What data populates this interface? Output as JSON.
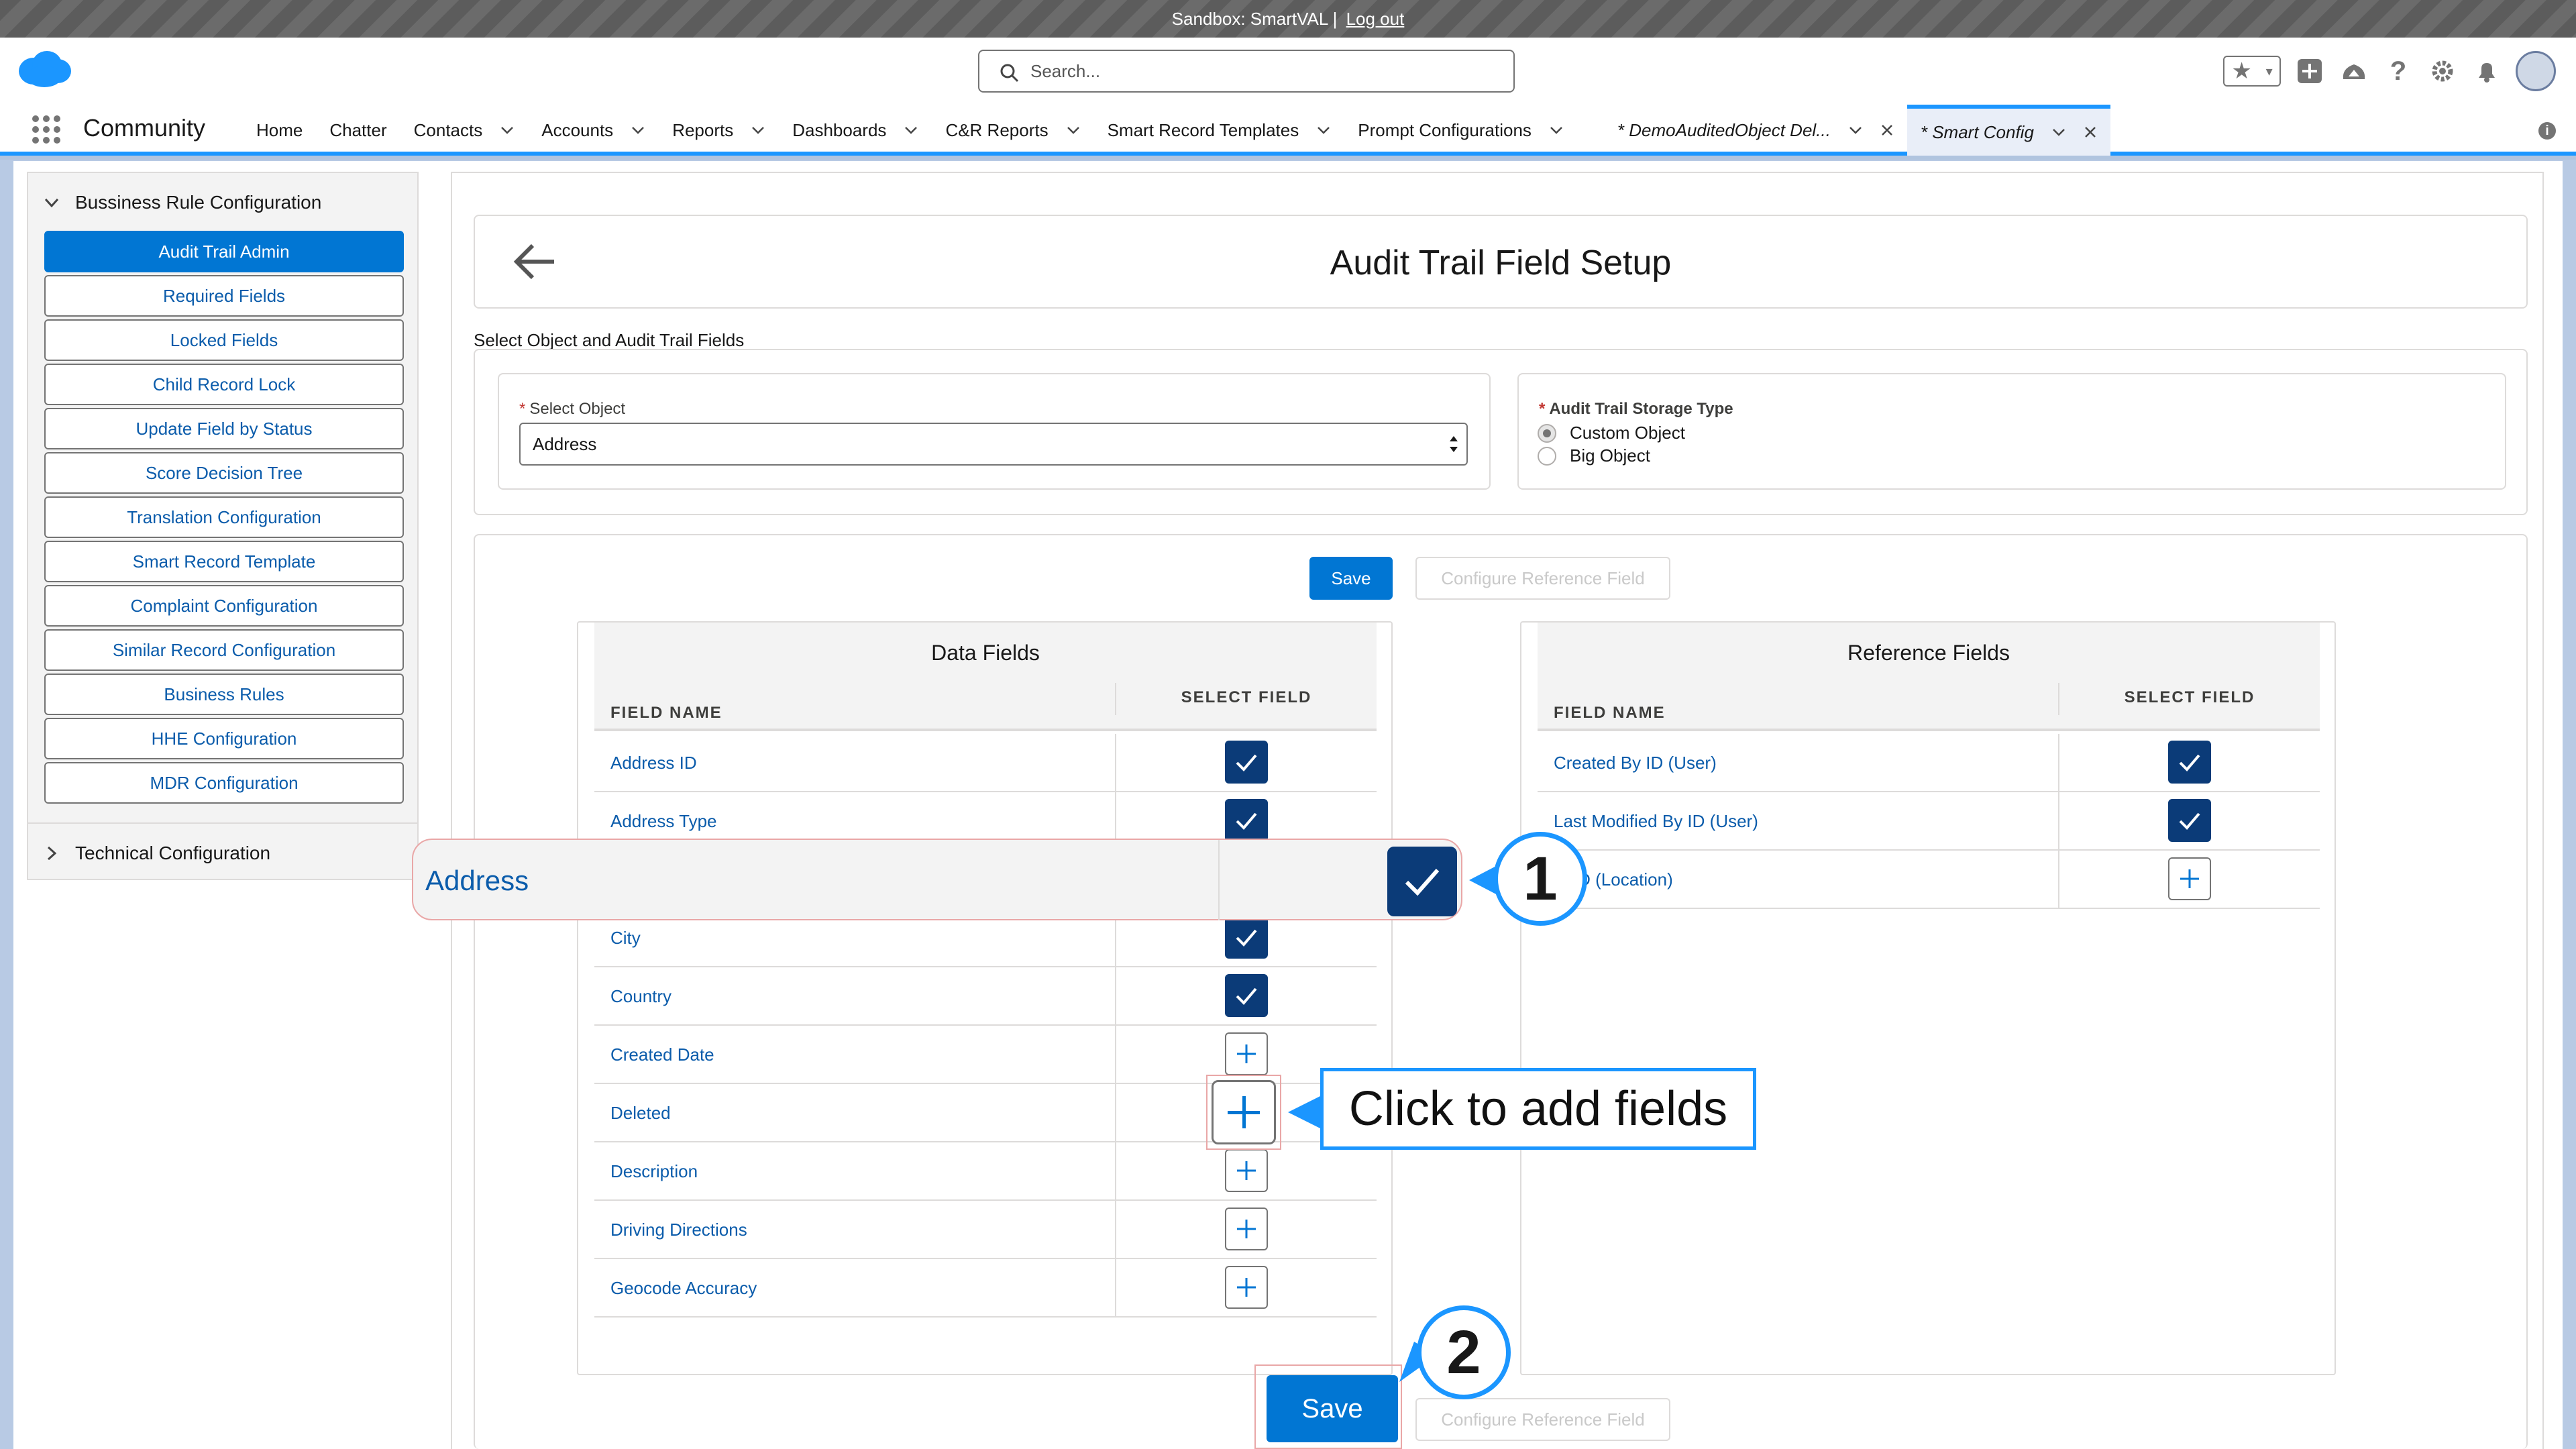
{
  "sandbox": {
    "text": "Sandbox: SmartVAL |",
    "logout": "Log out"
  },
  "header": {
    "search_placeholder": "Search...",
    "icons": [
      "favorites-star-icon",
      "add-icon",
      "trailhead-icon",
      "help-icon",
      "setup-gear-icon",
      "notifications-bell-icon",
      "user-avatar"
    ]
  },
  "nav": {
    "app_name": "Community",
    "items": [
      {
        "label": "Home",
        "chevron": false
      },
      {
        "label": "Chatter",
        "chevron": false
      },
      {
        "label": "Contacts",
        "chevron": true
      },
      {
        "label": "Accounts",
        "chevron": true
      },
      {
        "label": "Reports",
        "chevron": true
      },
      {
        "label": "Dashboards",
        "chevron": true
      },
      {
        "label": "C&R Reports",
        "chevron": true
      },
      {
        "label": "Smart Record Templates",
        "chevron": true
      },
      {
        "label": "Prompt Configurations",
        "chevron": true
      }
    ],
    "tabs": [
      {
        "label": "* DemoAuditedObject Del...",
        "active": false
      },
      {
        "label": "* Smart Config",
        "active": true
      }
    ]
  },
  "left_panel": {
    "section1": "Bussiness Rule Configuration",
    "buttons": [
      "Audit Trail Admin",
      "Required Fields",
      "Locked Fields",
      "Child Record Lock",
      "Update Field by Status",
      "Score Decision Tree",
      "Translation Configuration",
      "Smart Record Template",
      "Complaint Configuration",
      "Similar Record Configuration",
      "Business Rules",
      "HHE Configuration",
      "MDR Configuration"
    ],
    "active_index": 0,
    "section2": "Technical Configuration"
  },
  "main": {
    "title": "Audit Trail Field Setup",
    "section_label": "Select Object and Audit Trail Fields",
    "select_object": {
      "label": "Select Object",
      "value": "Address"
    },
    "storage_type": {
      "label": "Audit Trail Storage Type",
      "options": [
        "Custom Object",
        "Big Object"
      ],
      "selected": "Custom Object"
    },
    "save_label": "Save",
    "configure_ref_label": "Configure Reference Field"
  },
  "data_fields": {
    "title": "Data Fields",
    "col_name": "FIELD NAME",
    "col_select": "SELECT FIELD",
    "rows": [
      {
        "name": "Address ID",
        "selected": true
      },
      {
        "name": "Address Type",
        "selected": true
      },
      {
        "name": "Address",
        "selected": false
      },
      {
        "name": "City",
        "selected": true
      },
      {
        "name": "Country",
        "selected": true
      },
      {
        "name": "Created Date",
        "selected": false
      },
      {
        "name": "Deleted",
        "selected": false
      },
      {
        "name": "Description",
        "selected": false
      },
      {
        "name": "Driving Directions",
        "selected": false
      },
      {
        "name": "Geocode Accuracy",
        "selected": false
      }
    ]
  },
  "reference_fields": {
    "title": "Reference Fields",
    "col_name": "FIELD NAME",
    "col_select": "SELECT FIELD",
    "rows": [
      {
        "name": "Created By ID (User)",
        "selected": true
      },
      {
        "name": "Last Modified By ID (User)",
        "selected": true
      },
      {
        "name": "nt ID (Location)",
        "selected": false
      }
    ]
  },
  "callouts": {
    "zoom_field_name": "Address",
    "badge1": "1",
    "badge2": "2",
    "tip": "Click to add fields",
    "save_zoom_label": "Save"
  },
  "colors": {
    "brand": "#0176d3",
    "checked": "#0b3b78",
    "link": "#0b5cab",
    "callout": "#1b96ff"
  }
}
